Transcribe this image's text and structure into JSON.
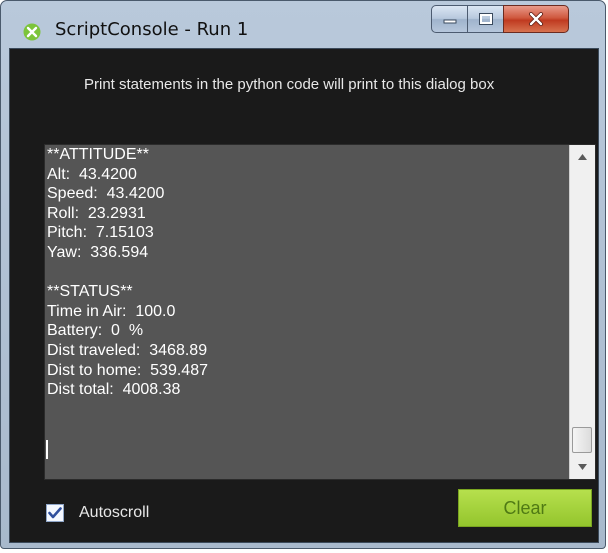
{
  "window": {
    "title": "ScriptConsole - Run 1",
    "icon": "scriptconsole-app-icon",
    "controls": {
      "minimize": "minimize-icon",
      "maximize": "maximize-icon",
      "close": "close-icon"
    }
  },
  "description": "Print statements in the python code will print to this dialog box",
  "console": {
    "lines": [
      "**ATTITUDE**",
      "Alt:  43.4200",
      "Speed:  43.4200",
      "Roll:  23.2931",
      "Pitch:  7.15103",
      "Yaw:  336.594",
      "",
      "**STATUS**",
      "Time in Air:  100.0",
      "Battery:  0  %",
      "Dist traveled:  3468.89",
      "Dist to home:  539.487",
      "Dist total:  4008.38"
    ]
  },
  "autoscroll": {
    "label": "Autoscroll",
    "checked": true
  },
  "clear_button": {
    "label": "Clear"
  },
  "colors": {
    "console_bg": "#555555",
    "dialog_bg": "#1a1a1a",
    "clear_button": "#a5d33b",
    "clear_text": "#4f7a14",
    "close_button": "#c8462b"
  }
}
